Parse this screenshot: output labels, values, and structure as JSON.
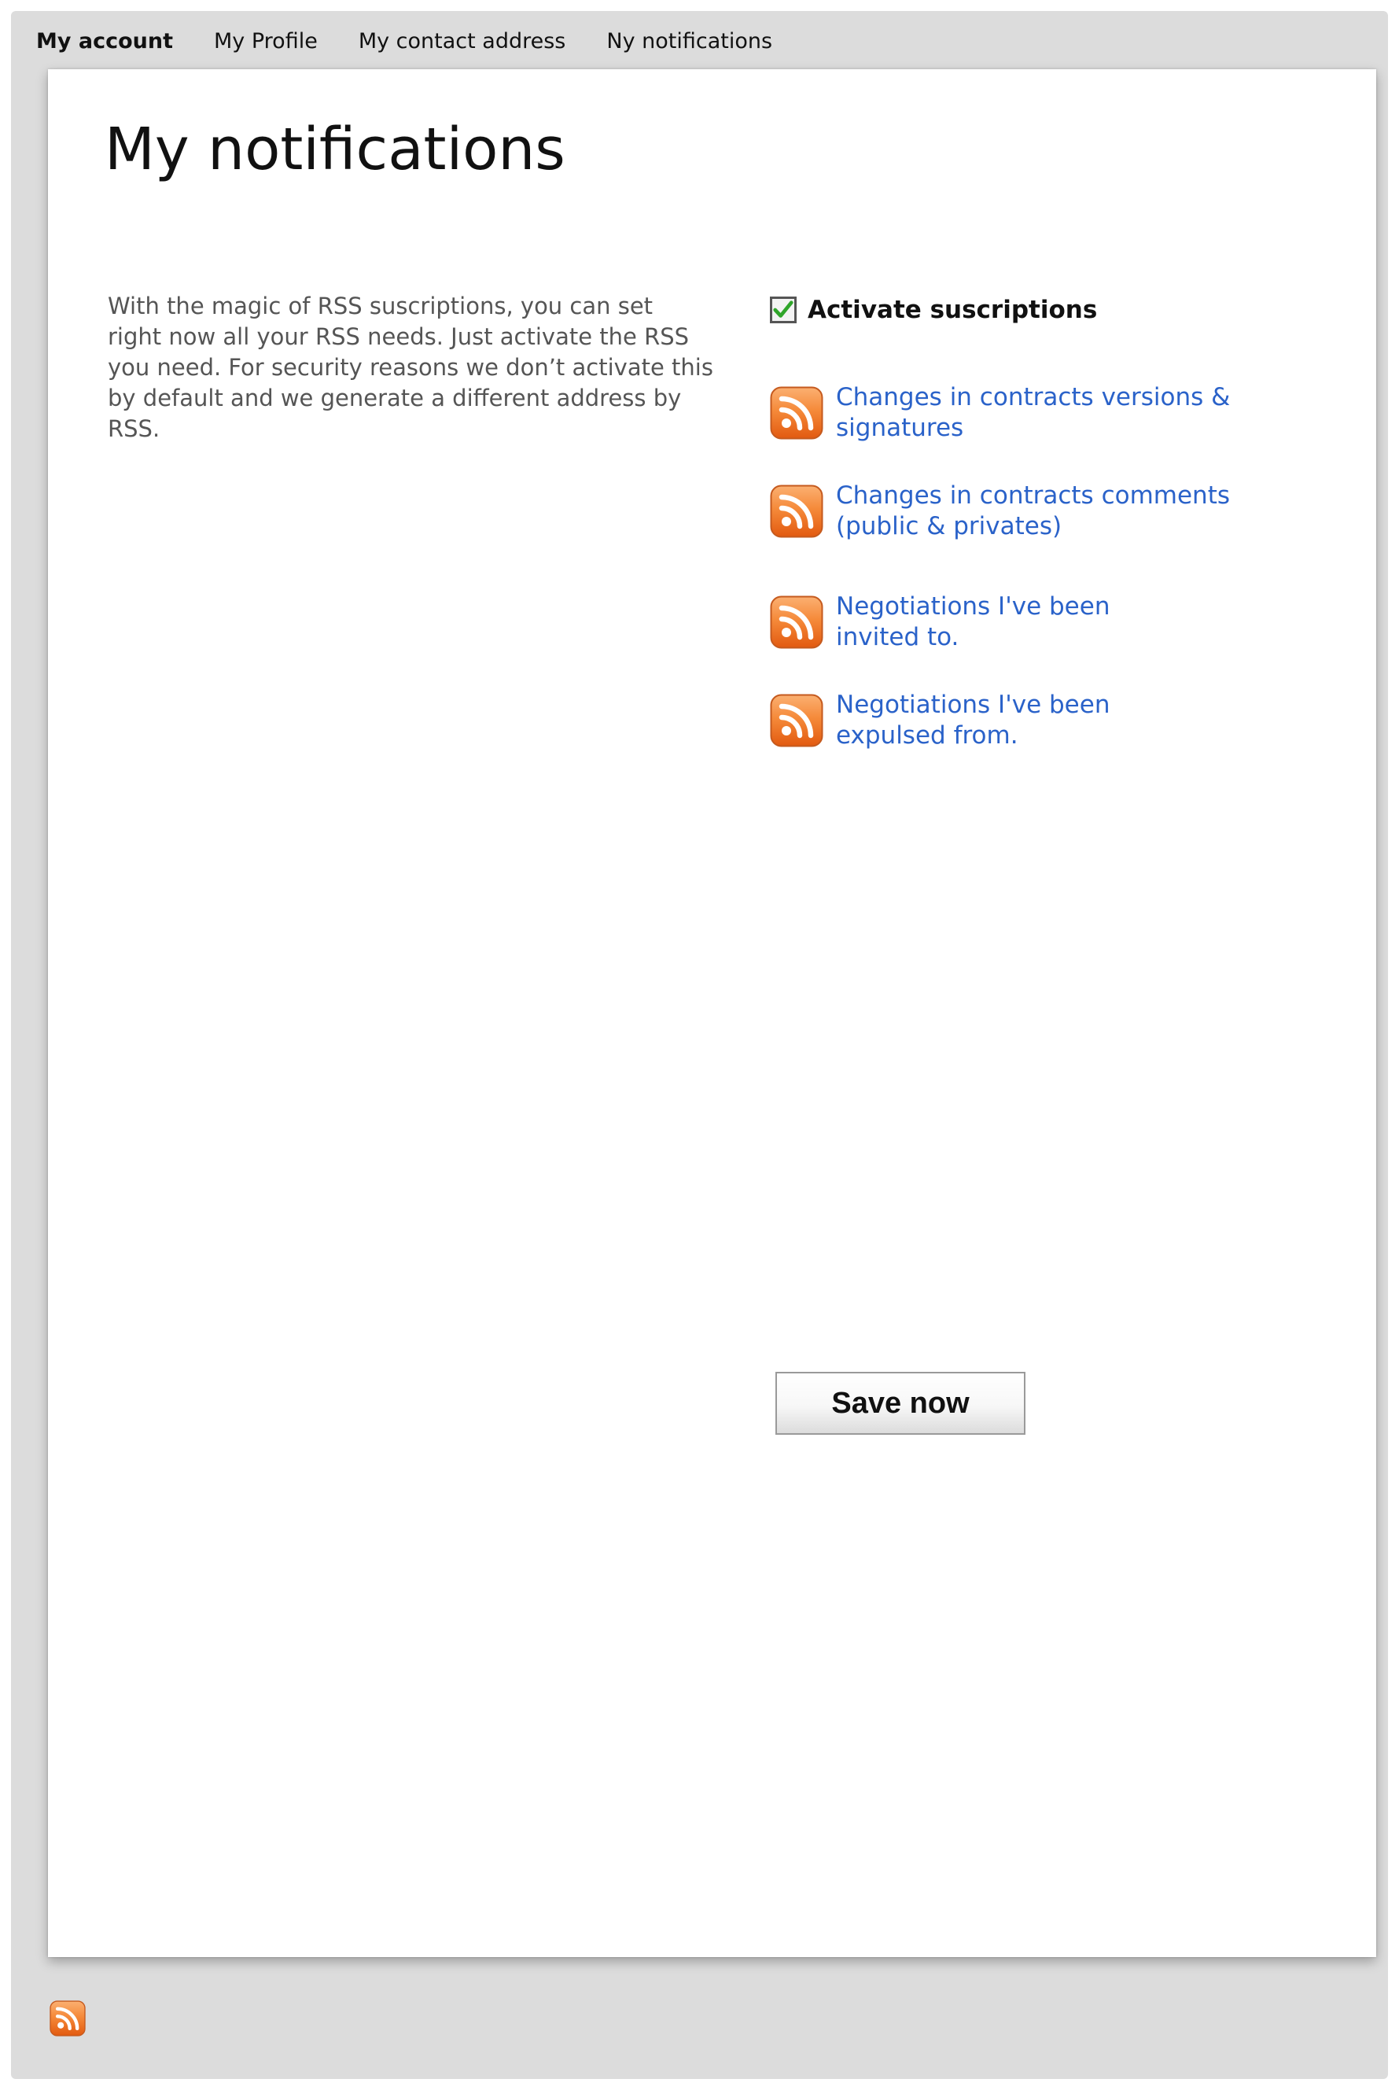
{
  "nav": {
    "items": [
      {
        "label": "My account"
      },
      {
        "label": "My Profile"
      },
      {
        "label": "My contact address"
      },
      {
        "label": "Ny notifications"
      }
    ]
  },
  "main": {
    "title": "My notifications",
    "intro": "With the magic of RSS suscriptions, you can set right now all your RSS needs. Just activate the RSS you need. For security reasons we don’t activate this by default and we generate a different address by RSS.",
    "activate_label": "Activate suscriptions",
    "activate_checked": true,
    "feeds": [
      {
        "label": "Changes in contracts versions & signatures",
        "icon": "rss-icon"
      },
      {
        "label": "Changes in contracts comments (public & privates)",
        "icon": "rss-icon"
      },
      {
        "label": "Negotiations I've been invited to.",
        "icon": "rss-icon"
      },
      {
        "label": "Negotiations I've been expulsed from.",
        "icon": "rss-icon"
      }
    ],
    "save_label": "Save now"
  },
  "colors": {
    "background": "#dcdcdc",
    "card": "#ffffff",
    "link": "#2a62c9",
    "rss_orange": "#f26f1d",
    "check_green": "#2fa52a"
  }
}
